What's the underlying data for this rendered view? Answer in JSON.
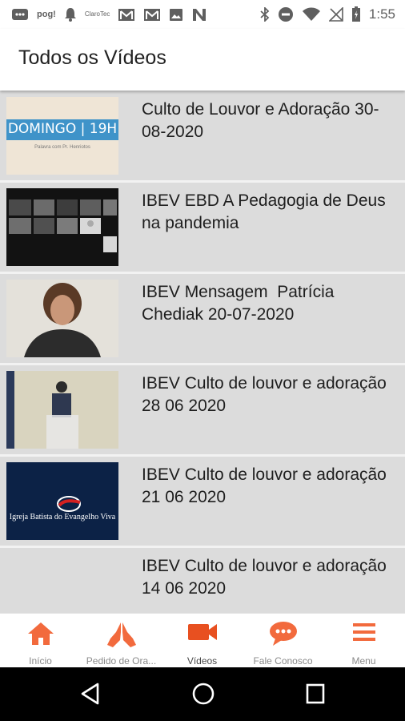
{
  "status_bar": {
    "carrier_text": "pog!",
    "small_text": "ClaroTec",
    "time": "1:55"
  },
  "header": {
    "title": "Todos os Vídeos"
  },
  "videos": [
    {
      "title": "Culto de Louvor e Adoração 30-08-2020",
      "thumb_text": "DOMINGO | 19H",
      "thumb_subtext": "Palavra com Pr. Henriotos"
    },
    {
      "title": "IBEV EBD A Pedagogia de Deus na pandemia"
    },
    {
      "title": "IBEV Mensagem  Patrícia Chediak 20-07-2020"
    },
    {
      "title": "IBEV Culto de louvor e adoração 28 06 2020"
    },
    {
      "title": "IBEV Culto de louvor e adoração 21 06 2020",
      "thumb_text": "Igreja Batista do Evangelho Viva"
    },
    {
      "title": "IBEV Culto de louvor e adoração 14 06 2020"
    }
  ],
  "bottom_nav": [
    {
      "label": "Início",
      "icon": "home-icon"
    },
    {
      "label": "Pedido de Ora...",
      "icon": "praying-hands-icon"
    },
    {
      "label": "Vídeos",
      "icon": "video-camera-icon",
      "active": true
    },
    {
      "label": "Fale Conosco",
      "icon": "chat-bubble-icon"
    },
    {
      "label": "Menu",
      "icon": "hamburger-menu-icon"
    }
  ],
  "colors": {
    "accent": "#f26a3d",
    "active_icon": "#e85020",
    "list_bg": "#dcdcdc"
  }
}
